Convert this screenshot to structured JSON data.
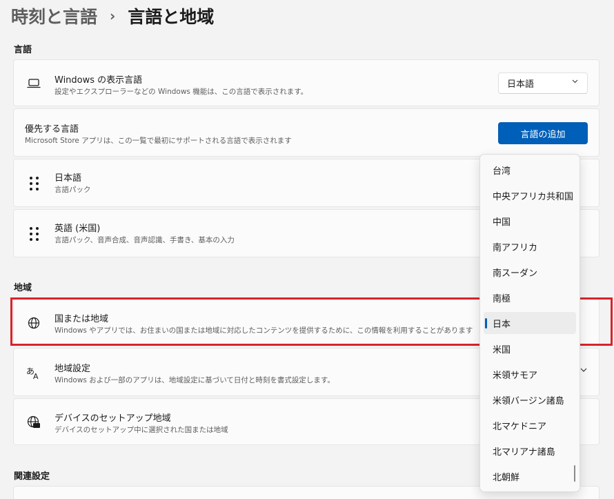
{
  "breadcrumb": {
    "parent": "時刻と言語",
    "separator": "›",
    "current": "言語と地域"
  },
  "sections": {
    "language": "言語",
    "region": "地域",
    "related": "関連設定"
  },
  "display_language": {
    "title": "Windows の表示言語",
    "desc": "設定やエクスプローラーなどの Windows 機能は、この言語で表示されます。",
    "value": "日本語",
    "icon": "laptop-icon"
  },
  "preferred_languages": {
    "title": "優先する言語",
    "desc": "Microsoft Store アプリは、この一覧で最初にサポートされる言語で表示されます",
    "add_button": "言語の追加"
  },
  "languages": [
    {
      "title": "日本語",
      "desc": "言語パック"
    },
    {
      "title": "英語 (米国)",
      "desc": "言語パック、音声合成、音声認識、手書き、基本の入力"
    }
  ],
  "country": {
    "title": "国または地域",
    "desc": "Windows やアプリでは、お住まいの国または地域に対応したコンテンツを提供するために、この情報を利用することがあります",
    "icon": "globe-icon"
  },
  "regional_format": {
    "title": "地域設定",
    "desc": "Windows および一部のアプリは、地域設定に基づいて日付と時刻を書式設定します。",
    "icon": "language-format-icon"
  },
  "device_setup_region": {
    "title": "デバイスのセットアップ地域",
    "desc": "デバイスのセットアップ中に選択された国または地域",
    "icon": "globe-device-icon"
  },
  "country_dropdown": {
    "items": [
      "台湾",
      "中央アフリカ共和国",
      "中国",
      "南アフリカ",
      "南スーダン",
      "南極",
      "日本",
      "米国",
      "米領サモア",
      "米領バージン諸島",
      "北マケドニア",
      "北マリアナ諸島",
      "北朝鮮"
    ],
    "selected": "日本"
  },
  "colors": {
    "accent": "#005fb8",
    "highlight_box": "#d9232a"
  }
}
